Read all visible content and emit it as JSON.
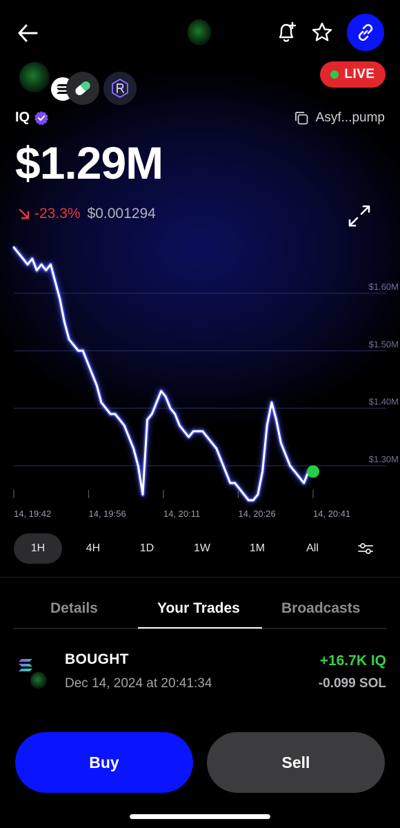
{
  "header": {
    "live_label": "LIVE",
    "ticker": "IQ",
    "address": "Asyf...pump"
  },
  "colors": {
    "accent": "#0a14ff",
    "live": "#e3262d",
    "positive": "#35d04a",
    "negative": "#f0353b",
    "line": "#ffffff",
    "marker": "#22d047"
  },
  "icons": {
    "back": "back-arrow-icon",
    "bell": "bell-plus-icon",
    "star": "star-icon",
    "link": "link-icon",
    "copy": "copy-icon",
    "expand": "expand-icon",
    "filter": "sliders-icon"
  },
  "market": {
    "market_cap": "$1.29M",
    "change": "-23.3%",
    "price": "$0.001294"
  },
  "chart_data": {
    "type": "line",
    "x_ticks": [
      "14, 19:42",
      "14, 19:56",
      "14, 20:11",
      "14, 20:26",
      "14, 20:41"
    ],
    "y_ticks": [
      "$1.60M",
      "$1.50M",
      "$1.40M",
      "$1.30M"
    ],
    "ylim": [
      1.24,
      1.69
    ],
    "grid": true,
    "series": [
      {
        "values": [
          1.68,
          1.67,
          1.66,
          1.65,
          1.66,
          1.64,
          1.65,
          1.64,
          1.65,
          1.62,
          1.59,
          1.55,
          1.52,
          1.51,
          1.5,
          1.5,
          1.48,
          1.46,
          1.44,
          1.41,
          1.4,
          1.39,
          1.39,
          1.38,
          1.37,
          1.35,
          1.33,
          1.3,
          1.25,
          1.38,
          1.39,
          1.41,
          1.43,
          1.42,
          1.4,
          1.39,
          1.37,
          1.36,
          1.35,
          1.36,
          1.36,
          1.36,
          1.35,
          1.34,
          1.33,
          1.31,
          1.29,
          1.27,
          1.27,
          1.26,
          1.25,
          1.24,
          1.24,
          1.25,
          1.29,
          1.37,
          1.41,
          1.38,
          1.34,
          1.32,
          1.3,
          1.29,
          1.28,
          1.27,
          1.29,
          1.29
        ]
      }
    ]
  },
  "ranges": [
    "1H",
    "4H",
    "1D",
    "1W",
    "1M",
    "All"
  ],
  "active_range": "1H",
  "tabs": [
    {
      "label": "Details"
    },
    {
      "label": "Your Trades"
    },
    {
      "label": "Broadcasts"
    }
  ],
  "trade": {
    "type": "BOUGHT",
    "time": "Dec 14, 2024 at 20:41:34",
    "amount": "+16.7K IQ",
    "sol": "-0.099 SOL"
  },
  "actions": {
    "buy": "Buy",
    "sell": "Sell"
  }
}
